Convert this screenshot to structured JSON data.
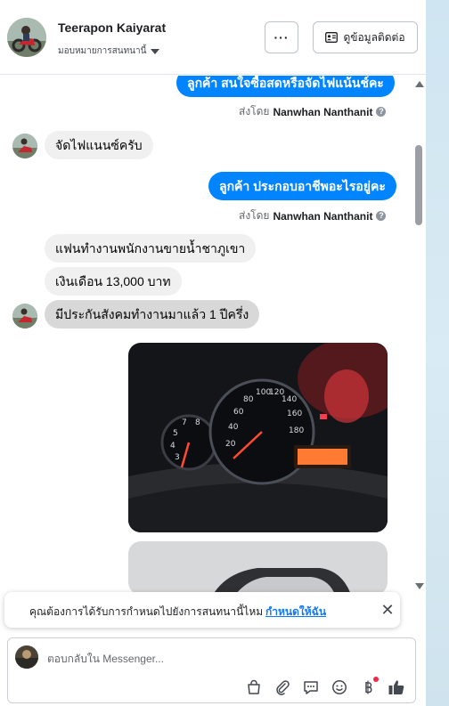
{
  "header": {
    "name": "Teerapon Kaiyarat",
    "subtitle": "มอบหมายการสนทนานี้",
    "more_label": "···",
    "contact_label": "ดูข้อมูลติดต่อ"
  },
  "messages": {
    "out1": "ลูกค้า สนใจซื้อสดหรือจัดไฟแน้นช์คะ",
    "sent_prefix": "ส่งโดย",
    "sender": "Nanwhan Nanthanit",
    "in1": "จัดไฟแนนซ์ครับ",
    "out2": "ลูกค้า ประกอบอาชีพอะไรอยู่คะ",
    "in2": "แฟนทำงานพนักงานขายน้ำชาภูเขา",
    "in3": "เงินเดือน 13,000 บาท",
    "in4": "มีประกันสังคมทำงานมาแล้ว 1 ปีครึ่ง"
  },
  "notice": {
    "text": "คุณต้องการได้รับการกำหนดไปยังการสนทนานี้ไหม",
    "link": "กำหนดให้ฉัน",
    "close": "✕"
  },
  "composer": {
    "placeholder": "ตอบกลับใน Messenger..."
  },
  "colors": {
    "accent": "#0084ff",
    "incoming": "#f0f0f0",
    "link": "#1877f2",
    "badge": "#f02849"
  },
  "icons": [
    "more-icon",
    "contact-card-icon",
    "help-icon",
    "close-icon",
    "shopping-bag-icon",
    "attachment-icon",
    "saved-reply-icon",
    "emoji-icon",
    "currency-icon",
    "thumbs-up-icon"
  ]
}
